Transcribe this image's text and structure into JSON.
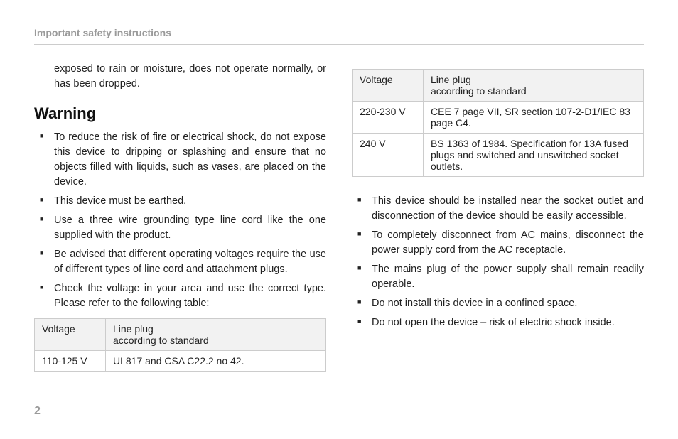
{
  "header": {
    "title": "Important safety instructions"
  },
  "left_column": {
    "continued_paragraph": "exposed to rain or moisture, does not operate normally, or has been dropped.",
    "warning_heading": "Warning",
    "bullets": [
      "To reduce the risk of fire or electrical shock, do not expose this device to dripping or splashing and ensure that no objects filled with liquids, such as vases, are placed on the device.",
      "This device must be earthed.",
      "Use a three wire grounding type line cord like the one supplied with the product.",
      "Be advised that different operating voltages require the use of different types of line cord and attachment plugs.",
      "Check the voltage in your area and use the correct type. Please refer to the following table:"
    ],
    "table": {
      "header_col1": "Voltage",
      "header_col2_line1": "Line plug",
      "header_col2_line2": "according to standard",
      "rows": [
        {
          "voltage": "110-125 V",
          "plug": "UL817 and CSA C22.2 no 42."
        }
      ]
    }
  },
  "right_column": {
    "table": {
      "header_col1": "Voltage",
      "header_col2_line1": "Line plug",
      "header_col2_line2": "according to standard",
      "rows": [
        {
          "voltage": "220-230 V",
          "plug": "CEE 7 page VII, SR section 107-2-D1/IEC 83 page C4."
        },
        {
          "voltage": "240 V",
          "plug": "BS 1363 of 1984. Specification for 13A fused plugs and switched and unswitched socket outlets."
        }
      ]
    },
    "bullets": [
      "This device should be installed near the socket outlet and disconnection of the device should be easily accessible.",
      "To completely disconnect from AC mains, disconnect the power supply cord from the AC receptacle.",
      "The mains plug of the power supply shall remain readily operable.",
      "Do not install this device in a confined space.",
      "Do not open the device – risk of electric shock inside."
    ]
  },
  "page_number": "2"
}
